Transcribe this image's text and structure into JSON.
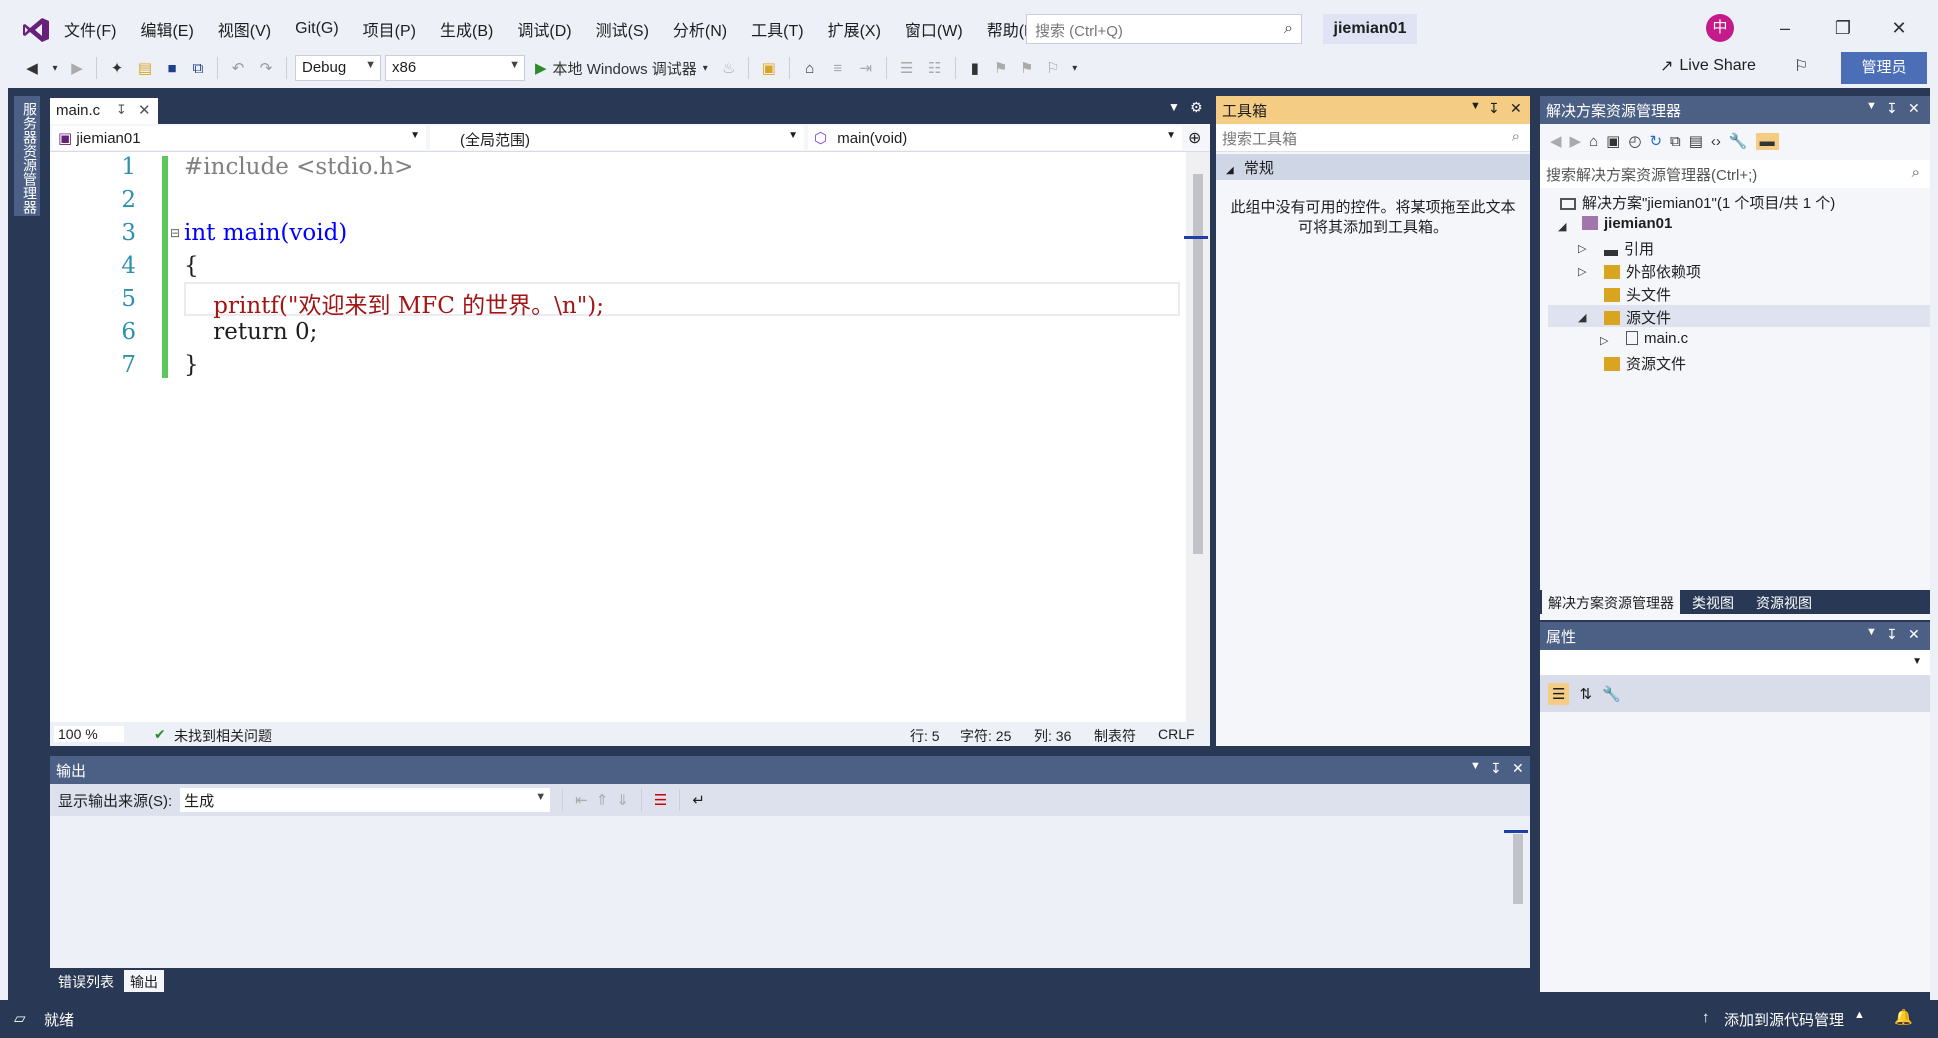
{
  "menu": [
    "文件(F)",
    "编辑(E)",
    "视图(V)",
    "Git(G)",
    "项目(P)",
    "生成(B)",
    "调试(D)",
    "测试(S)",
    "分析(N)",
    "工具(T)",
    "扩展(X)",
    "窗口(W)",
    "帮助(H)"
  ],
  "search": {
    "placeholder": "搜索 (Ctrl+Q)"
  },
  "solution_name": "jiemian01",
  "avatar_initial": "中",
  "toolbar": {
    "config": "Debug",
    "platform": "x86",
    "run_label": "本地 Windows 调试器",
    "live_share": "Live Share",
    "admin": "管理员"
  },
  "left_strip": {
    "server_explorer": "服务器资源管理器"
  },
  "editor": {
    "tab_name": "main.c",
    "nav_project": "jiemian01",
    "nav_scope": "(全局范围)",
    "nav_member": "main(void)",
    "lines": [
      {
        "num": "1",
        "text": "#include <stdio.h>"
      },
      {
        "num": "2",
        "text": ""
      },
      {
        "num": "3",
        "text": "int main(void)"
      },
      {
        "num": "4",
        "text": "{"
      },
      {
        "num": "5",
        "text": "    printf(\"欢迎来到 MFC 的世界。\\n\");"
      },
      {
        "num": "6",
        "text": "    return 0;"
      },
      {
        "num": "7",
        "text": "}"
      }
    ],
    "zoom": "100 %",
    "issues": "未找到相关问题",
    "status_line": "行: 5",
    "status_char": "字符: 25",
    "status_col": "列: 36",
    "status_tab": "制表符",
    "status_eol": "CRLF"
  },
  "toolbox": {
    "title": "工具箱",
    "search_placeholder": "搜索工具箱",
    "group": "常规",
    "empty_message": "此组中没有可用的控件。将某项拖至此文本可将其添加到工具箱。"
  },
  "solution_explorer": {
    "title": "解决方案资源管理器",
    "search_placeholder": "搜索解决方案资源管理器(Ctrl+;)",
    "solution_label": "解决方案\"jiemian01\"(1 个项目/共 1 个)",
    "project": "jiemian01",
    "items": [
      "引用",
      "外部依赖项",
      "头文件",
      "源文件",
      "main.c",
      "资源文件"
    ],
    "tabs": [
      "解决方案资源管理器",
      "类视图",
      "资源视图"
    ]
  },
  "properties": {
    "title": "属性"
  },
  "output": {
    "title": "输出",
    "source_label": "显示输出来源(S):",
    "source_value": "生成",
    "tabs": [
      "错误列表",
      "输出"
    ]
  },
  "statusbar": {
    "ready": "就绪",
    "add_source_control": "添加到源代码管理"
  },
  "colors": {
    "accent": "#4c6eb6",
    "frame": "#293955",
    "active_tab": "#f5cc84",
    "modified_gutter": "#5cc75c"
  }
}
